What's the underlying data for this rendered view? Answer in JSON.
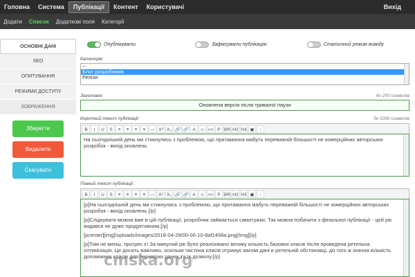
{
  "topnav": {
    "items": [
      "Головна",
      "Система",
      "Публікації",
      "Контент",
      "Користувачі"
    ],
    "active": 2,
    "exit": "Вихід"
  },
  "subnav": {
    "items": [
      "Додати",
      "Список",
      "Додаткові поля",
      "Категорії"
    ],
    "active": 1
  },
  "sidebar": {
    "tabs": [
      "Основні дані",
      "SEO",
      "Опитування",
      "Режими доступу",
      "Зображення"
    ],
    "save": "Зберегти",
    "delete": "Видалити",
    "cancel": "Скасувати"
  },
  "toggles": {
    "published": "Опублікувати",
    "pinned": "Зафіксувати публікацію",
    "static": "Статичний режим виводу"
  },
  "categories": {
    "label": "Категорія:",
    "options": [
      "--",
      "Блог розробників",
      "Релізи"
    ],
    "selected": 1
  },
  "title": {
    "label": "Заголовок:",
    "hint": "до 250 символів",
    "value": "Оновлена версія після тривалої паузи"
  },
  "short_text": {
    "label": "Короткий текст публікації:",
    "hint": "до 1000 символів",
    "value": "На сьогоднішній день ми стикнулись з проблемою, що притаманна мабуть переважній більшості не комерційних авторських розробок - вихід оновлень"
  },
  "full_text": {
    "label": "Повний текст публікації:",
    "paragraphs": [
      "[p]На сьогоднішній день ми стикнулись з проблемою, що притаманна мабуть переважній більшості не комерційних авторських розробок - вихід оновлень.[/p]",
      "[p]Слідкувати можна вже в цій публікації, розробник займається самотужки. Так можна побачити з фінальної публікації - цей рік видався не дуже продуктивним.[/p]",
      "[pcenter][img]/uploads/images/2018-04-29/00-06-10-8af1458a.png[/img][/p]",
      "[p]Тим не менш, прогрес є! За минулий рік було реалізовано велику кількість базових класів після проведена ретельна оптимізація. Це досить важливо, оскільки частина класів отримує вагомі дані в ретельній обстановці, до того ж значна кількість допоміжних класів для перевірки даних та їх дозволу.[/p]"
    ]
  },
  "watermark": "cmska.org",
  "toolbar_icons": [
    "B",
    "I",
    "U",
    "S",
    "≡",
    "≡",
    "≡",
    "≡",
    "—",
    "X²",
    "X₂",
    "🔗",
    "🔗",
    "A",
    "☺",
    "<>",
    "P",
    "BR",
    "H2",
    "H3",
    "▣",
    "↑"
  ]
}
